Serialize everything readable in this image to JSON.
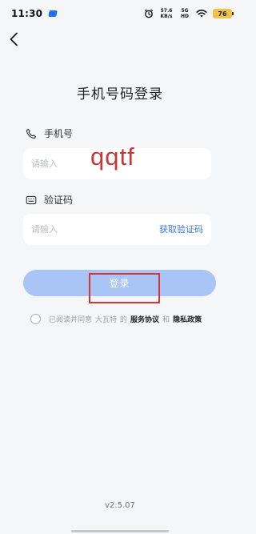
{
  "status_bar": {
    "time": "11:30",
    "speed_value": "57.6",
    "speed_unit": "KB/s",
    "network_top": "5G",
    "network_bottom": "HD",
    "battery": "76"
  },
  "page": {
    "title": "手机号码登录"
  },
  "form": {
    "phone_label": "手机号",
    "phone_placeholder": "请输入",
    "code_label": "验证码",
    "code_placeholder": "请输入",
    "get_code_label": "获取验证码",
    "login_label": "登录"
  },
  "agreement": {
    "prefix": "已阅读并同意",
    "company": "大瓦特",
    "possessive": "的",
    "service_label": "服务协议",
    "conjunction": "和",
    "privacy_label": "隐私政策"
  },
  "overlay": {
    "handwriting": "qqtf"
  },
  "footer": {
    "version": "v2.5.07"
  },
  "icons": {
    "back": "back-arrow-icon",
    "phone": "phone-icon",
    "code": "keyboard-icon",
    "checkbox": "radio-icon"
  },
  "colors": {
    "primary": "#3f79ea",
    "login_disabled": "#a9c4f7",
    "annotation": "#d93333",
    "background": "#f5f6f8"
  }
}
